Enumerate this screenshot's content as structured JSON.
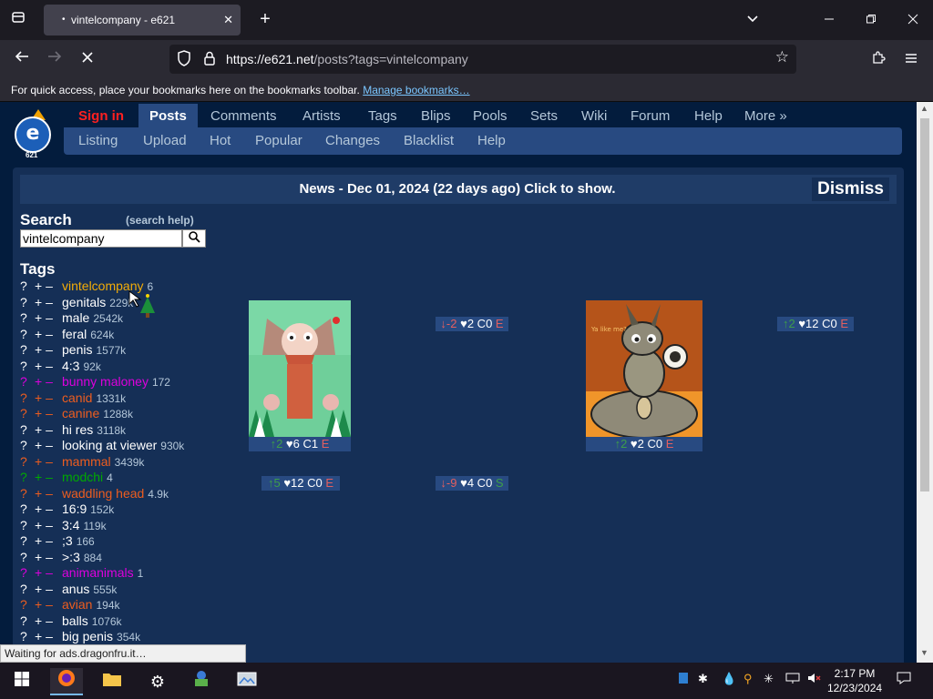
{
  "browser": {
    "tab_title": "vintelcompany - e621",
    "tab_dot": "•",
    "new_tab": "+",
    "url_host": "https://e621.net",
    "url_path": "/posts?tags=vintelcompany",
    "bookmark_hint": "For quick access, place your bookmarks here on the bookmarks toolbar.",
    "bookmark_link": "Manage bookmarks…"
  },
  "site": {
    "logo_letter": "e",
    "logo_small": "621",
    "topnav": [
      "Sign in",
      "Posts",
      "Comments",
      "Artists",
      "Tags",
      "Blips",
      "Pools",
      "Sets",
      "Wiki",
      "Forum",
      "Help",
      "More »"
    ],
    "subnav": [
      "Listing",
      "Upload",
      "Hot",
      "Popular",
      "Changes",
      "Blacklist",
      "Help"
    ],
    "news": "News - Dec 01, 2024 (22 days ago) Click to show.",
    "dismiss": "Dismiss",
    "search_title": "Search",
    "search_help": "(search help)",
    "search_value": "vintelcompany",
    "tags_title": "Tags",
    "tags": [
      {
        "name": "vintelcompany",
        "count": "6",
        "type": "artist"
      },
      {
        "name": "genitals",
        "count": "229k",
        "type": "general"
      },
      {
        "name": "male",
        "count": "2542k",
        "type": "general"
      },
      {
        "name": "feral",
        "count": "624k",
        "type": "general"
      },
      {
        "name": "penis",
        "count": "1577k",
        "type": "general"
      },
      {
        "name": "4:3",
        "count": "92k",
        "type": "meta"
      },
      {
        "name": "bunny maloney",
        "count": "172",
        "type": "copyright"
      },
      {
        "name": "canid",
        "count": "1331k",
        "type": "species"
      },
      {
        "name": "canine",
        "count": "1288k",
        "type": "species"
      },
      {
        "name": "hi res",
        "count": "3118k",
        "type": "meta"
      },
      {
        "name": "looking at viewer",
        "count": "930k",
        "type": "general"
      },
      {
        "name": "mammal",
        "count": "3439k",
        "type": "species"
      },
      {
        "name": "modchi",
        "count": "4",
        "type": "character"
      },
      {
        "name": "waddling head",
        "count": "4.9k",
        "type": "species"
      },
      {
        "name": "16:9",
        "count": "152k",
        "type": "meta"
      },
      {
        "name": "3:4",
        "count": "119k",
        "type": "meta"
      },
      {
        "name": ";3",
        "count": "166",
        "type": "general"
      },
      {
        "name": ">:3",
        "count": "884",
        "type": "general"
      },
      {
        "name": "animanimals",
        "count": "1",
        "type": "copyright"
      },
      {
        "name": "anus",
        "count": "555k",
        "type": "general"
      },
      {
        "name": "avian",
        "count": "194k",
        "type": "species"
      },
      {
        "name": "balls",
        "count": "1076k",
        "type": "general"
      },
      {
        "name": "big penis",
        "count": "354k",
        "type": "general"
      }
    ],
    "tag_q": "?",
    "tag_plus": "+",
    "tag_minus": "–",
    "posts": [
      {
        "score": "2",
        "dir": "up",
        "favs": "6",
        "comments": "1",
        "rating": "E"
      },
      {
        "score": "-2",
        "dir": "down",
        "favs": "2",
        "comments": "0",
        "rating": "E"
      },
      {
        "score": "2",
        "dir": "up",
        "favs": "2",
        "comments": "0",
        "rating": "E"
      },
      {
        "score": "2",
        "dir": "up",
        "favs": "12",
        "comments": "0",
        "rating": "E"
      },
      {
        "score": "5",
        "dir": "up",
        "favs": "12",
        "comments": "0",
        "rating": "E"
      },
      {
        "score": "-9",
        "dir": "down",
        "favs": "4",
        "comments": "0",
        "rating": "S"
      }
    ],
    "post2_caption": "Ya like me?"
  },
  "status_text": "Waiting for ads.dragonfru.it…",
  "clock": {
    "time": "2:17 PM",
    "date": "12/23/2024"
  }
}
